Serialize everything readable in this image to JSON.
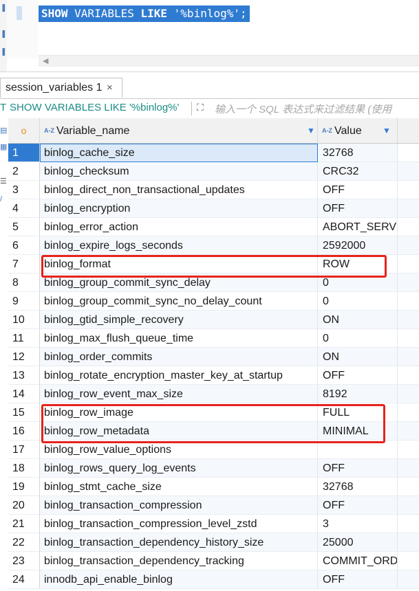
{
  "editor": {
    "query_keyword_1": "SHOW",
    "query_middle": " VARIABLES ",
    "query_keyword_2": "LIKE",
    "query_end": " '%binlog%';"
  },
  "result_tab": {
    "label": "session_variables 1",
    "close": "×"
  },
  "filter_bar": {
    "icon": "T",
    "query": "SHOW VARIABLES LIKE '%binlog%'",
    "expand_icon": "expand-icon",
    "placeholder": "输入一个 SQL 表达式来过滤结果 (使用"
  },
  "grid": {
    "rownum_header_icon": "o",
    "sort_badge": "A-Z",
    "columns": {
      "name": "Variable_name",
      "value": "Value"
    },
    "rows": [
      {
        "num": "1",
        "name": "binlog_cache_size",
        "value": "32768"
      },
      {
        "num": "2",
        "name": "binlog_checksum",
        "value": "CRC32"
      },
      {
        "num": "3",
        "name": "binlog_direct_non_transactional_updates",
        "value": "OFF"
      },
      {
        "num": "4",
        "name": "binlog_encryption",
        "value": "OFF"
      },
      {
        "num": "5",
        "name": "binlog_error_action",
        "value": "ABORT_SERVE"
      },
      {
        "num": "6",
        "name": "binlog_expire_logs_seconds",
        "value": "2592000"
      },
      {
        "num": "7",
        "name": "binlog_format",
        "value": "ROW"
      },
      {
        "num": "8",
        "name": "binlog_group_commit_sync_delay",
        "value": "0"
      },
      {
        "num": "9",
        "name": "binlog_group_commit_sync_no_delay_count",
        "value": "0"
      },
      {
        "num": "10",
        "name": "binlog_gtid_simple_recovery",
        "value": "ON"
      },
      {
        "num": "11",
        "name": "binlog_max_flush_queue_time",
        "value": "0"
      },
      {
        "num": "12",
        "name": "binlog_order_commits",
        "value": "ON"
      },
      {
        "num": "13",
        "name": "binlog_rotate_encryption_master_key_at_startup",
        "value": "OFF"
      },
      {
        "num": "14",
        "name": "binlog_row_event_max_size",
        "value": "8192"
      },
      {
        "num": "15",
        "name": "binlog_row_image",
        "value": "FULL"
      },
      {
        "num": "16",
        "name": "binlog_row_metadata",
        "value": "MINIMAL"
      },
      {
        "num": "17",
        "name": "binlog_row_value_options",
        "value": ""
      },
      {
        "num": "18",
        "name": "binlog_rows_query_log_events",
        "value": "OFF"
      },
      {
        "num": "19",
        "name": "binlog_stmt_cache_size",
        "value": "32768"
      },
      {
        "num": "20",
        "name": "binlog_transaction_compression",
        "value": "OFF"
      },
      {
        "num": "21",
        "name": "binlog_transaction_compression_level_zstd",
        "value": "3"
      },
      {
        "num": "22",
        "name": "binlog_transaction_dependency_history_size",
        "value": "25000"
      },
      {
        "num": "23",
        "name": "binlog_transaction_dependency_tracking",
        "value": "COMMIT_ORD"
      },
      {
        "num": "24",
        "name": "innodb_api_enable_binlog",
        "value": "OFF"
      }
    ]
  },
  "colors": {
    "selection_blue": "#2f7bd1",
    "annotation_red": "#e8221b",
    "filter_teal": "#1a8c86"
  }
}
